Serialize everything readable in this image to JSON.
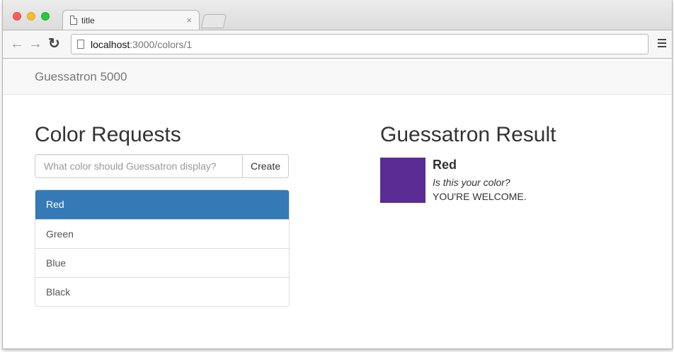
{
  "browser": {
    "tab_title": "title",
    "tab_close": "×",
    "url_host": "localhost",
    "url_path": ":3000/colors/1"
  },
  "navbar": {
    "brand": "Guessatron 5000"
  },
  "requests": {
    "heading": "Color Requests",
    "input_placeholder": "What color should Guessatron display?",
    "input_value": "",
    "create_label": "Create",
    "items": [
      {
        "label": "Red",
        "active": true
      },
      {
        "label": "Green",
        "active": false
      },
      {
        "label": "Blue",
        "active": false
      },
      {
        "label": "Black",
        "active": false
      }
    ]
  },
  "result": {
    "heading": "Guessatron Result",
    "color_name": "Red",
    "swatch_color": "#5b2c94",
    "question": "Is this your color?",
    "answer": "YOU'RE WELCOME."
  },
  "colors": {
    "active_item": "#337ab7"
  }
}
